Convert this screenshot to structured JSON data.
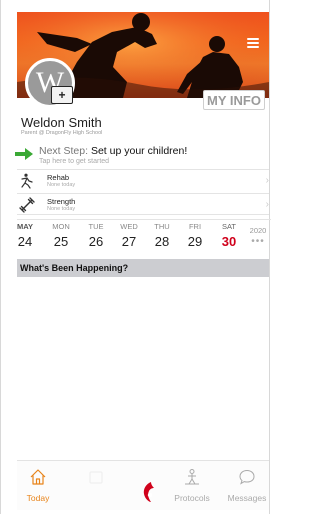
{
  "header": {
    "menu_icon": "hamburger-menu-icon",
    "avatar_letter": "W",
    "add_photo_icon": "add-photo-icon",
    "add_photo_glyph": "+",
    "my_info_label": "MY INFO"
  },
  "profile": {
    "name": "Weldon Smith",
    "subtitle": "Parent @ DragonFly High School"
  },
  "next_step": {
    "prefix": "Next Step:",
    "action": "Set up your children!",
    "hint": "Tap here to get started"
  },
  "activities": [
    {
      "title": "Rehab",
      "sub": "None today",
      "icon": "rehab-icon"
    },
    {
      "title": "Strength",
      "sub": "None today",
      "icon": "strength-icon"
    }
  ],
  "week": {
    "days": [
      {
        "name": "MAY",
        "date": "24"
      },
      {
        "name": "MON",
        "date": "25"
      },
      {
        "name": "TUE",
        "date": "26"
      },
      {
        "name": "WED",
        "date": "27"
      },
      {
        "name": "THU",
        "date": "28"
      },
      {
        "name": "FRI",
        "date": "29"
      },
      {
        "name": "SAT",
        "date": "30"
      }
    ],
    "year": "2020",
    "more": "•••"
  },
  "section": {
    "title": "What's Been Happening?"
  },
  "tabs": [
    {
      "label": "Today",
      "icon": "home-icon",
      "active": true
    },
    {
      "label": "",
      "icon": "calendar-icon",
      "active": false
    },
    {
      "label": "",
      "icon": "dragonfly-logo",
      "active": false
    },
    {
      "label": "Protocols",
      "icon": "protocols-icon",
      "active": false
    },
    {
      "label": "Messages",
      "icon": "chat-bubble-icon",
      "active": false
    }
  ],
  "colors": {
    "accent": "#e8841a",
    "today": "#d0011b",
    "next_step_arrow": "#3aa935",
    "hero": "#f0521e"
  }
}
